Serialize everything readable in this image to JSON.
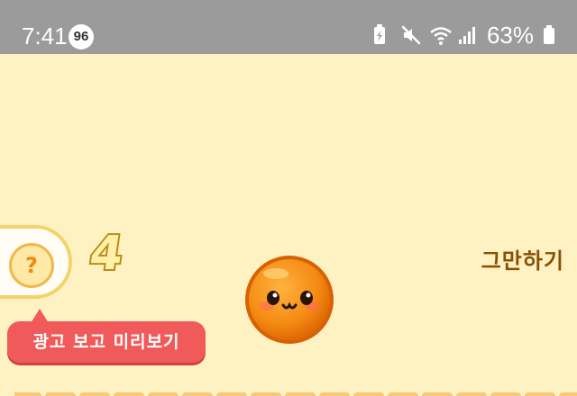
{
  "status_bar": {
    "time": "7:41",
    "notification_count": "96",
    "battery_percent": "63%",
    "icons": [
      "battery-saver-icon",
      "mute-icon",
      "wifi-icon",
      "signal-icon",
      "battery-icon"
    ]
  },
  "game": {
    "help_symbol": "?",
    "counter": "4",
    "quit_label": "그만하기",
    "ad_button_label": "광고 보고 미리보기",
    "character": "orange-ball-face"
  },
  "colors": {
    "background": "#fff2c2",
    "status_bar": "#9b9b9b",
    "ad_button": "#f15a5a",
    "quit_text": "#8a4f05",
    "ball": "#f48a12",
    "track": "#f7c97b"
  }
}
